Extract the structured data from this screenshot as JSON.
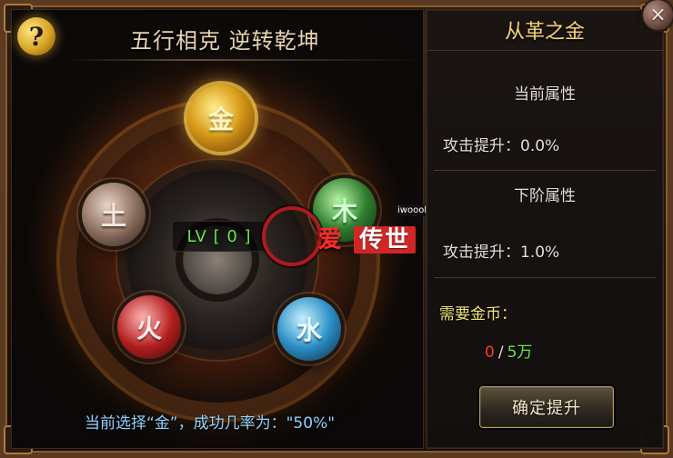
{
  "window": {
    "help_icon": "question-mark-icon",
    "left_title": "五行相克  逆转乾坤",
    "right_title": "从革之金",
    "close_icon": "close-icon"
  },
  "left": {
    "elements": [
      {
        "label": "金",
        "name": "gold"
      },
      {
        "label": "木",
        "name": "wood"
      },
      {
        "label": "水",
        "name": "water"
      },
      {
        "label": "火",
        "name": "fire"
      },
      {
        "label": "土",
        "name": "earth"
      }
    ],
    "level_text": "LV [ 0 ]",
    "selection_text": "当前选择“金”，成功几率为：\"50%\""
  },
  "right": {
    "current_attr_title": "当前属性",
    "current_attr_value": "攻击提升：0.0%",
    "next_attr_title": "下阶属性",
    "next_attr_value": "攻击提升：1.0%",
    "need_gold_label": "需要金币：",
    "gold_current": "0",
    "gold_separator": "/",
    "gold_required": "5万",
    "confirm_button": "确定提升"
  },
  "watermark": {
    "text_left": "爱",
    "text_right": "传世",
    "tag": "iwoool"
  },
  "colors": {
    "accent_gold": "#f3d27a",
    "level_green": "#6fe24e",
    "info_blue": "#8fd3ff",
    "cost_red": "#ff3b2f",
    "cost_green": "#73e24f"
  }
}
